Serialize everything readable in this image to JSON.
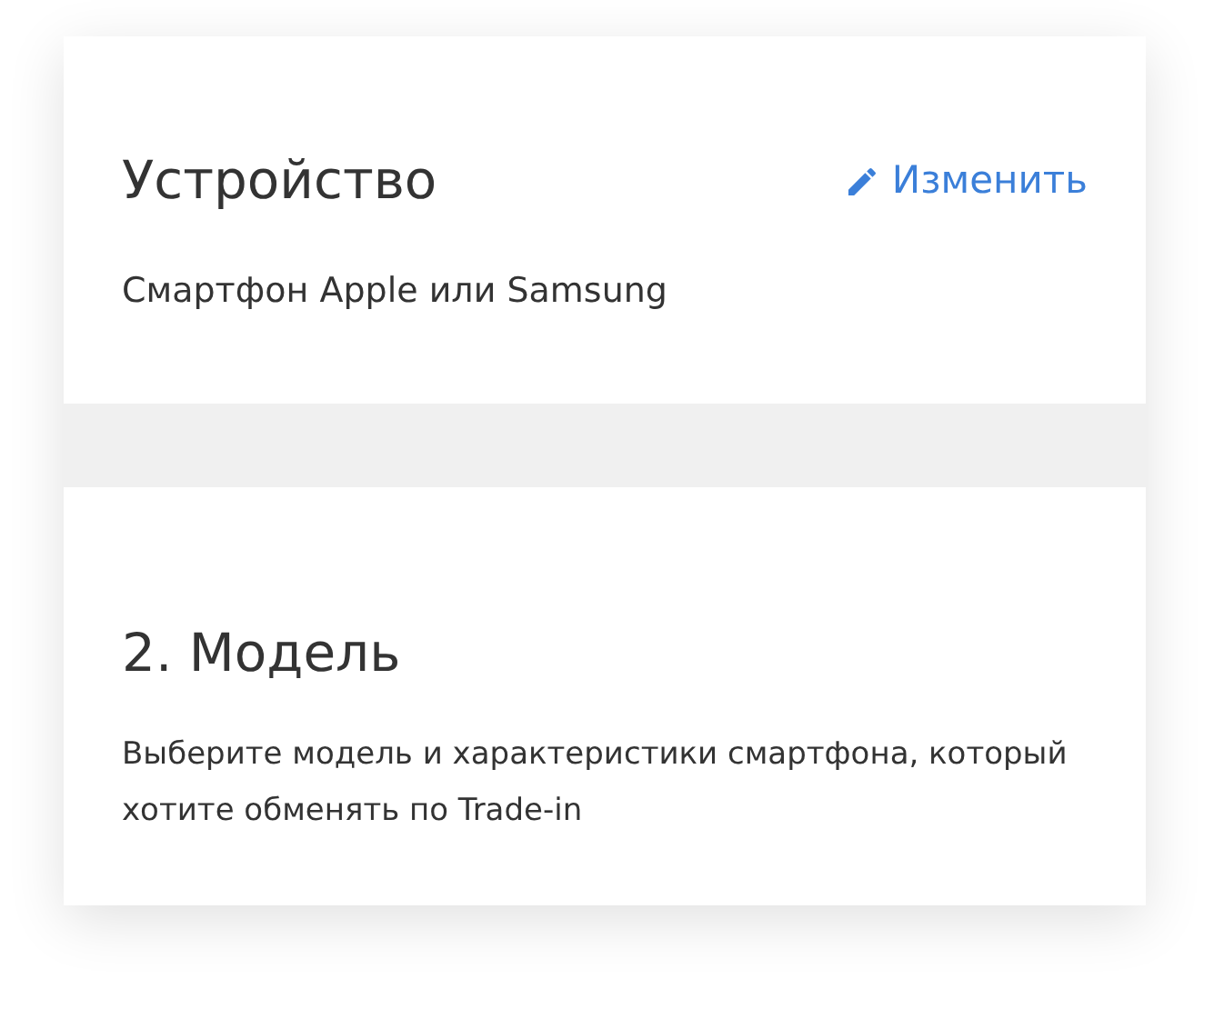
{
  "device": {
    "title": "Устройство",
    "edit_link": "Изменить",
    "value": "Смартфон Apple или Samsung"
  },
  "model": {
    "title": "2. Модель",
    "description": "Выберите модель и характеристики смартфона, который хотите обменять по Trade-in"
  }
}
